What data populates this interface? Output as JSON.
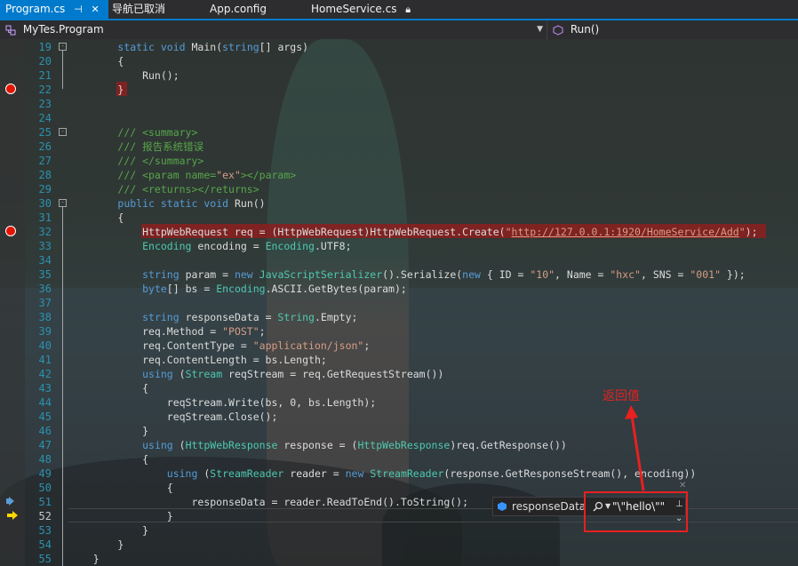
{
  "tabs": [
    {
      "label": "Program.cs",
      "icons": [
        "pin-icon",
        "close-icon"
      ],
      "active": true
    },
    {
      "label": "导航已取消"
    },
    {
      "label": "App.config"
    },
    {
      "label": "HomeService.cs",
      "icons": [
        "lock-icon"
      ]
    }
  ],
  "nav": {
    "class_selector": "MyTes.Program",
    "member_selector": "Run()"
  },
  "lines": [
    {
      "n": "19",
      "html": "        <span class='kw'>static</span> <span class='kw'>void</span> Main(<span class='kw'>string</span>[] args)"
    },
    {
      "n": "20",
      "html": "        {"
    },
    {
      "n": "21",
      "html": "            Run();"
    },
    {
      "n": "22",
      "html": "        }"
    },
    {
      "n": "23",
      "html": ""
    },
    {
      "n": "24",
      "html": ""
    },
    {
      "n": "25",
      "html": "        <span class='cm'>/// &lt;summary&gt;</span>"
    },
    {
      "n": "26",
      "html": "        <span class='cm'>/// 报告系统错误</span>"
    },
    {
      "n": "27",
      "html": "        <span class='cm'>/// &lt;/summary&gt;</span>"
    },
    {
      "n": "28",
      "html": "        <span class='cm'>/// &lt;param name=</span><span class='st'>\"ex\"</span><span class='cm'>&gt;&lt;/param&gt;</span>"
    },
    {
      "n": "29",
      "html": "        <span class='cm'>/// &lt;returns&gt;&lt;/returns&gt;</span>"
    },
    {
      "n": "30",
      "html": "        <span class='kw'>public</span> <span class='kw'>static</span> <span class='kw'>void</span> Run()"
    },
    {
      "n": "31",
      "html": "        {"
    },
    {
      "n": "32",
      "html": "            HttpWebRequest req = (HttpWebRequest)HttpWebRequest.Create(<span class='st'>\"</span><span class='url'>http://127.0.0.1:1920/HomeService/Add</span><span class='st'>\"</span>);"
    },
    {
      "n": "33",
      "html": "            <span class='ty'>Encoding</span> encoding = <span class='ty'>Encoding</span>.UTF8;"
    },
    {
      "n": "34",
      "html": ""
    },
    {
      "n": "35",
      "html": "            <span class='kw'>string</span> param = <span class='kw'>new</span> <span class='ty'>JavaScriptSerializer</span>().Serialize(<span class='kw'>new</span> { ID = <span class='st'>\"10\"</span>, Name = <span class='st'>\"hxc\"</span>, SNS = <span class='st'>\"001\"</span> });"
    },
    {
      "n": "36",
      "html": "            <span class='kw'>byte</span>[] bs = <span class='ty'>Encoding</span>.ASCII.GetBytes(param);"
    },
    {
      "n": "37",
      "html": ""
    },
    {
      "n": "38",
      "html": "            <span class='kw'>string</span> responseData = <span class='ty'>String</span>.Empty;"
    },
    {
      "n": "39",
      "html": "            req.Method = <span class='st'>\"POST\"</span>;"
    },
    {
      "n": "40",
      "html": "            req.ContentType = <span class='st'>\"application/json\"</span>;"
    },
    {
      "n": "41",
      "html": "            req.ContentLength = bs.Length;"
    },
    {
      "n": "42",
      "html": "            <span class='kw'>using</span> (<span class='ty'>Stream</span> reqStream = req.GetRequestStream())"
    },
    {
      "n": "43",
      "html": "            {"
    },
    {
      "n": "44",
      "html": "                reqStream.Write(bs, 0, bs.Length);"
    },
    {
      "n": "45",
      "html": "                reqStream.Close();"
    },
    {
      "n": "46",
      "html": "            }"
    },
    {
      "n": "47",
      "html": "            <span class='kw'>using</span> (<span class='ty'>HttpWebResponse</span> response = (<span class='ty'>HttpWebResponse</span>)req.GetResponse())"
    },
    {
      "n": "48",
      "html": "            {"
    },
    {
      "n": "49",
      "html": "                <span class='kw'>using</span> (<span class='ty'>StreamReader</span> reader = <span class='kw'>new</span> <span class='ty'>StreamReader</span>(response.GetResponseStream(), encoding))"
    },
    {
      "n": "50",
      "html": "                {"
    },
    {
      "n": "51",
      "html": "                    responseData = reader.ReadToEnd().ToString();"
    },
    {
      "n": "52",
      "html": "                }"
    },
    {
      "n": "53",
      "html": "            }"
    },
    {
      "n": "54",
      "html": "        }"
    },
    {
      "n": "55",
      "html": "    }"
    }
  ],
  "datatip": {
    "name": "responseData",
    "value": "\"\\\"hello\\\"\"",
    "pin_icon": "pin-icon",
    "expand_icon": "expand-icon",
    "close_icon": "close-icon"
  },
  "annotation": {
    "label": "返回值",
    "color": "#e82020"
  },
  "colors": {
    "accent": "#007acc",
    "breakpoint": "#e51400",
    "line_number": "#2b91af"
  }
}
